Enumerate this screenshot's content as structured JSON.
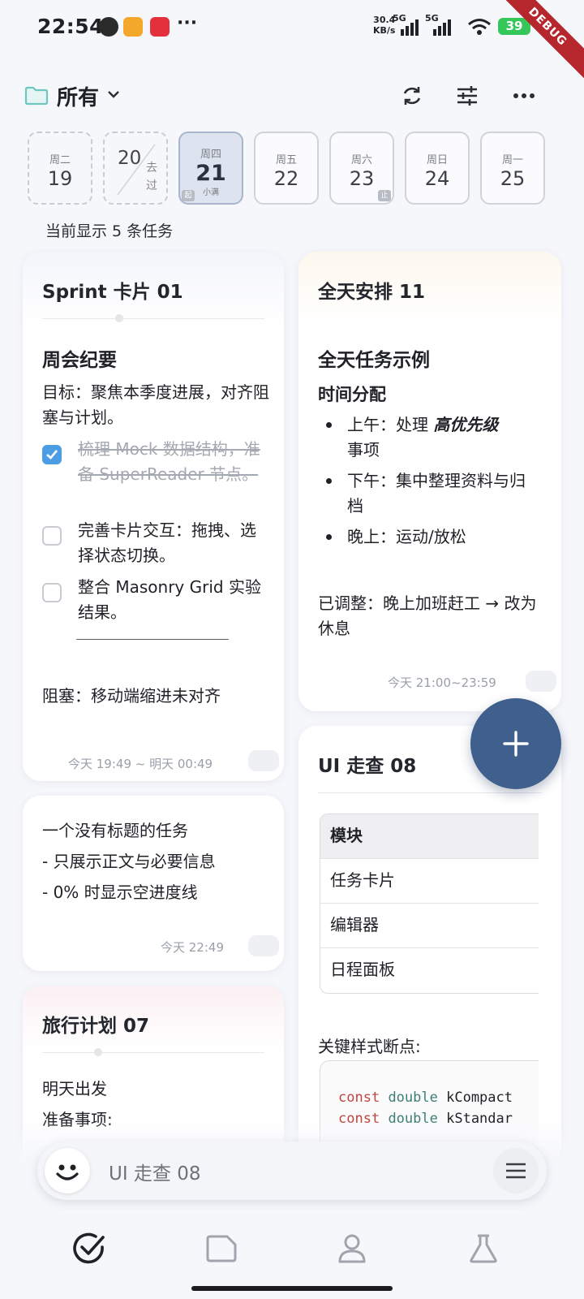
{
  "status_bar": {
    "time": "22:54",
    "net_speed_value": "30.4",
    "net_speed_unit": "KB/s",
    "signal1_label": "5G",
    "signal2_label": "5G",
    "wifi_label": "7",
    "battery": "39",
    "debug_label": "DEBUG"
  },
  "header": {
    "title": "所有",
    "icons": [
      "folder-icon",
      "chevron-down-icon",
      "sync-icon",
      "filter-icon",
      "more-icon"
    ]
  },
  "date_strip": {
    "past_prefix_day": "20",
    "past_label": "去过",
    "days": [
      {
        "week": "周二",
        "day": "19",
        "state": "past"
      },
      {
        "week": "周四",
        "day": "21",
        "state": "today",
        "term": "小满",
        "badge": "起"
      },
      {
        "week": "周五",
        "day": "22"
      },
      {
        "week": "周六",
        "day": "23",
        "badge": "止"
      },
      {
        "week": "周日",
        "day": "24"
      },
      {
        "week": "周一",
        "day": "25"
      }
    ]
  },
  "task_count": "当前显示 5 条任务",
  "cards": {
    "sprint": {
      "title": "Sprint 卡片 01",
      "heading": "周会纪要",
      "goal": "目标：聚焦本季度进展，对齐阻塞与计划。",
      "checklist": [
        {
          "text": "梳理 Mock 数据结构，准备 SuperReader 节点。",
          "done": true
        },
        {
          "text": "完善卡片交互：拖拽、选择状态切换。",
          "done": false
        },
        {
          "text": "整合 Masonry Grid 实验结果。",
          "done": false
        }
      ],
      "blocker": "阻塞：移动端缩进未对齐",
      "time": "今天 19:49 ~ 明天 00:49"
    },
    "untitled": {
      "lines": [
        "一个没有标题的任务",
        "- 只展示正文与必要信息",
        "- 0% 时显示空进度线"
      ],
      "time": "今天 22:49"
    },
    "travel": {
      "title": "旅行计划 07",
      "line1": "明天出发",
      "line2": "准备事项:"
    },
    "allday": {
      "title": "全天安排 11",
      "heading": "全天任务示例",
      "sub": "时间分配",
      "morning_prefix": "上午：处理 ",
      "morning_emph": "高优先级",
      "morning_suffix": "事项",
      "afternoon": "下午：集中整理资料与归档",
      "evening": "晚上：运动/放松",
      "adjusted": "已调整：晚上加班赶工 → 改为休息",
      "time": "今天 21:00~23:59"
    },
    "ui_check": {
      "title": "UI 走查 08",
      "table_header": "模块",
      "table_rows": [
        "任务卡片",
        "编辑器",
        "日程面板"
      ],
      "breakpoints_label": "关键样式断点:",
      "code_kw": "const",
      "code_type": "double",
      "code_line1_name": "kCompact",
      "code_line2_name": "kStandar"
    }
  },
  "chat_bar": {
    "text": "UI 走查 08"
  },
  "bottom_nav": {
    "items": [
      "tasks-icon",
      "folder-tab-icon",
      "profile-icon",
      "lab-flask-icon"
    ]
  }
}
